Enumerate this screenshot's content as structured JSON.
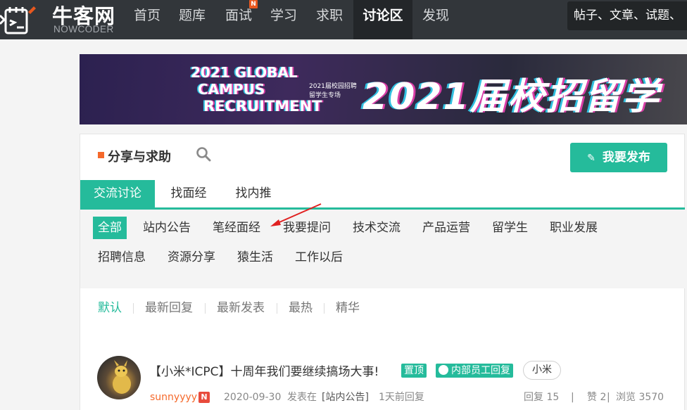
{
  "header": {
    "logo_cn": "牛客网",
    "logo_en": "NOWCODER",
    "nav": [
      {
        "label": "首页"
      },
      {
        "label": "题库"
      },
      {
        "label": "面试",
        "badge": "N"
      },
      {
        "label": "学习"
      },
      {
        "label": "求职"
      },
      {
        "label": "讨论区",
        "active": true
      },
      {
        "label": "发现"
      }
    ],
    "search_placeholder": "帖子、文章、试题、"
  },
  "banner": {
    "line1": "2021 GLOBAL",
    "line2": "CAMPUS",
    "line3": "RECRUITMENT",
    "sub1": "2021届校园招聘",
    "sub2": "留学生专场",
    "big": "2021届校招留学"
  },
  "section": {
    "title": "分享与求助",
    "post_button": "我要发布"
  },
  "tabs": [
    {
      "label": "交流讨论",
      "active": true
    },
    {
      "label": "找面经"
    },
    {
      "label": "找内推"
    }
  ],
  "categories": [
    {
      "label": "全部",
      "active": true
    },
    {
      "label": "站内公告"
    },
    {
      "label": "笔经面经"
    },
    {
      "label": "我要提问"
    },
    {
      "label": "技术交流"
    },
    {
      "label": "产品运营"
    },
    {
      "label": "留学生"
    },
    {
      "label": "职业发展"
    },
    {
      "label": "招聘信息"
    },
    {
      "label": "资源分享"
    },
    {
      "label": "猿生活"
    },
    {
      "label": "工作以后"
    }
  ],
  "sorts": [
    {
      "label": "默认",
      "active": true
    },
    {
      "label": "最新回复"
    },
    {
      "label": "最新发表"
    },
    {
      "label": "最热"
    },
    {
      "label": "精华"
    }
  ],
  "post": {
    "title": "【小米*ICPC】十周年我们要继续搞场大事!",
    "tags": [
      "置顶",
      "内部员工回复"
    ],
    "pill": "小米",
    "author": "sunnyyyy",
    "author_badge": "N",
    "date": "2020-09-30",
    "posted_in_prefix": "发表在",
    "board": "[站内公告]",
    "last_reply": "1天前回复",
    "replies": "回复 15",
    "likes": "赞 2",
    "views": "浏览 3570"
  },
  "colors": {
    "accent": "#25bb9b",
    "topbar": "#32363a",
    "orange": "#f5692b",
    "arrow": "#e02020"
  }
}
